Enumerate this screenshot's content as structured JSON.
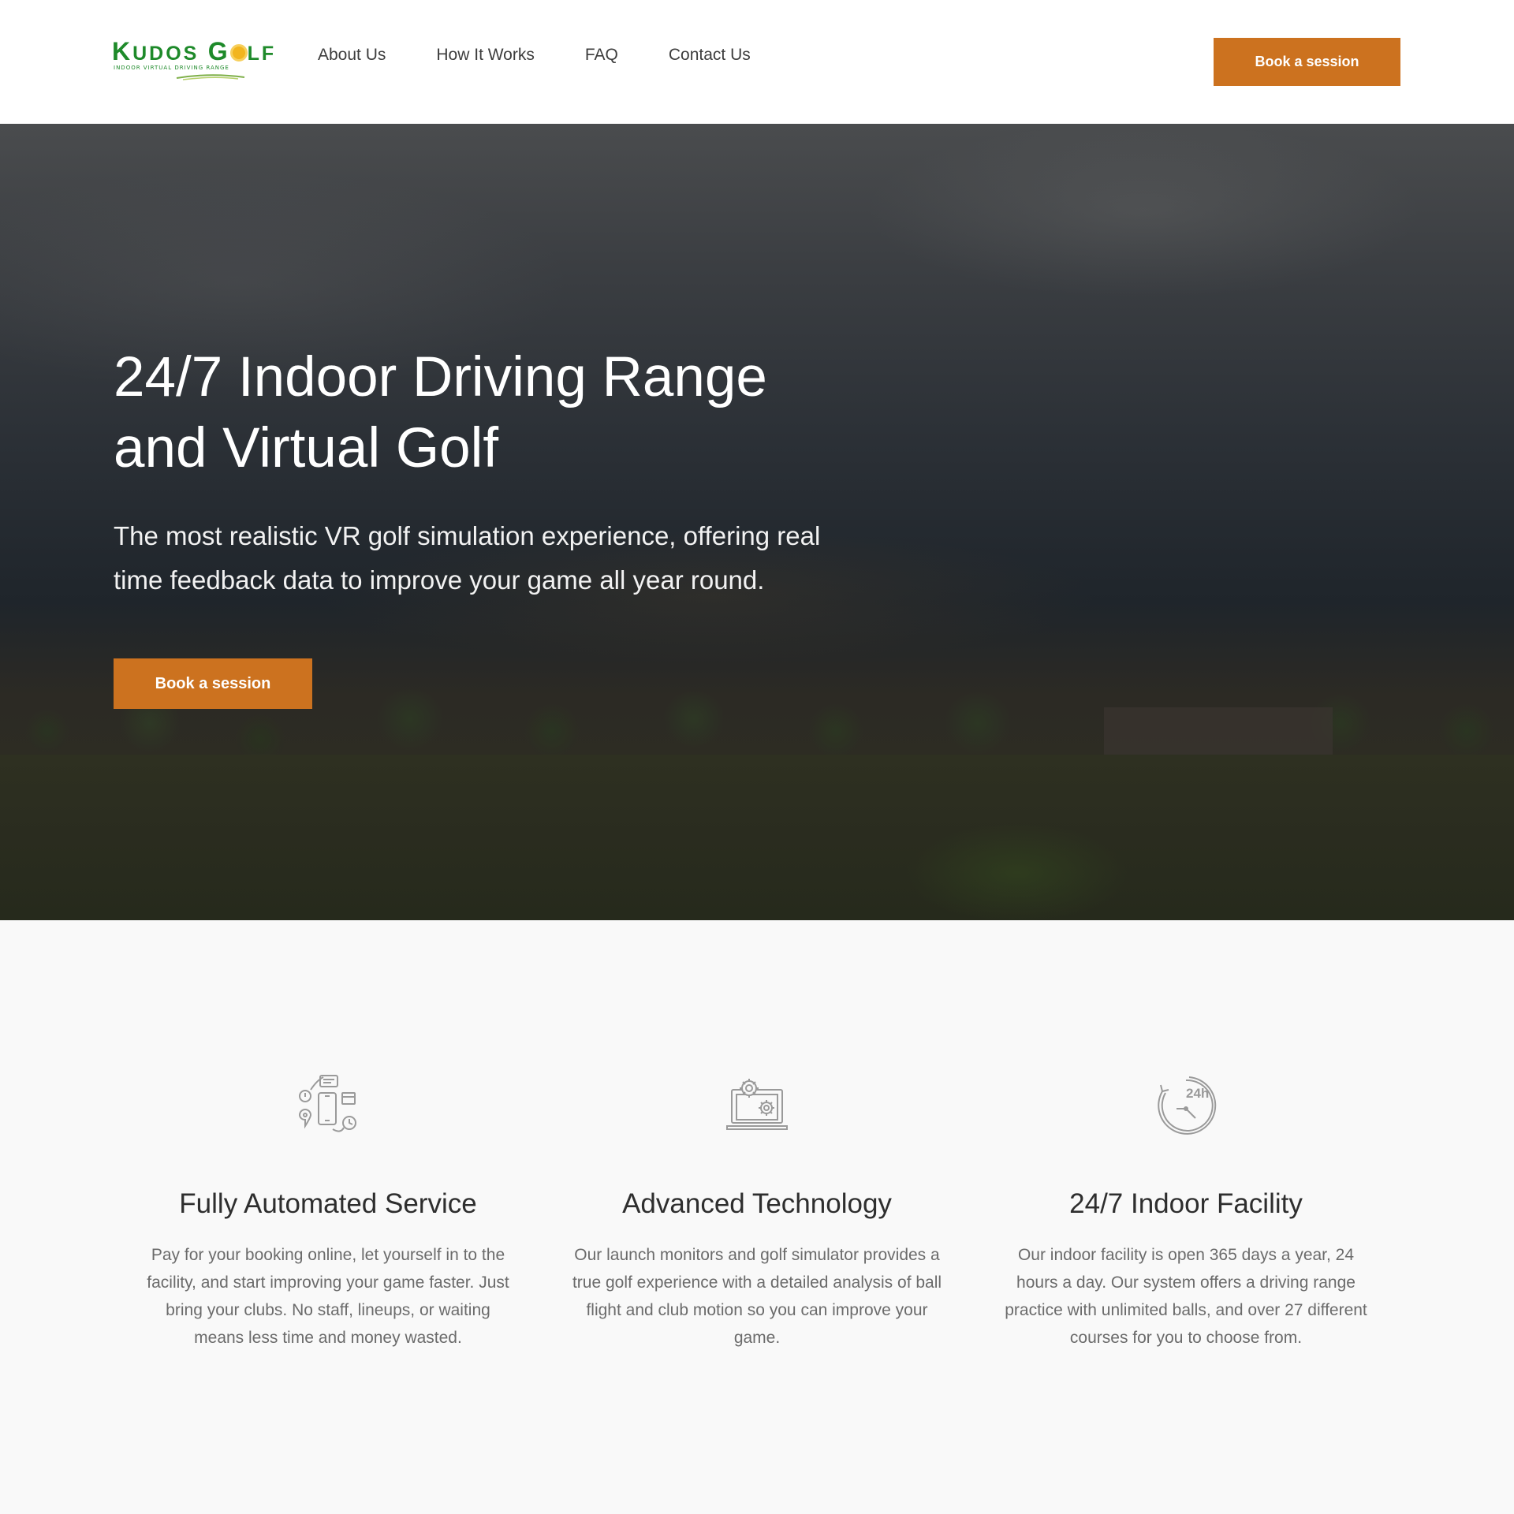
{
  "brand": {
    "logo_word_1": "K",
    "logo_word_2": "UDOS",
    "logo_word_3": "G",
    "logo_word_4": "LF",
    "logo_tagline": "INDOOR VIRTUAL DRIVING RANGE",
    "primary_color": "#1e8a2a",
    "accent_color": "#cc721f"
  },
  "nav": {
    "items": [
      {
        "label": "About Us"
      },
      {
        "label": "How It Works"
      },
      {
        "label": "FAQ"
      },
      {
        "label": "Contact Us"
      }
    ],
    "cta_label": "Book a session"
  },
  "hero": {
    "title_line_1": "24/7 Indoor Driving Range",
    "title_line_2": "and Virtual Golf",
    "subtitle": "The most realistic VR golf simulation experience, offering real time feedback data to improve your game all year round.",
    "cta_label": "Book a session"
  },
  "features": [
    {
      "icon": "automation-devices-icon",
      "title": "Fully Automated Service",
      "text": "Pay for your booking online, let yourself in to the facility, and start improving your game faster. Just bring your clubs. No staff, lineups, or waiting means less time and money wasted."
    },
    {
      "icon": "laptop-gears-icon",
      "title": "Advanced Technology",
      "text": "Our launch monitors and golf simulator provides a true golf experience with a detailed analysis of ball flight and club motion so you can improve your game."
    },
    {
      "icon": "clock-24h-icon",
      "icon_text": "24h",
      "title": "24/7 Indoor Facility",
      "text": "Our indoor facility is open 365 days a year, 24 hours a day. Our system offers a driving range practice with unlimited balls, and over 27 different courses for you to choose from."
    }
  ]
}
